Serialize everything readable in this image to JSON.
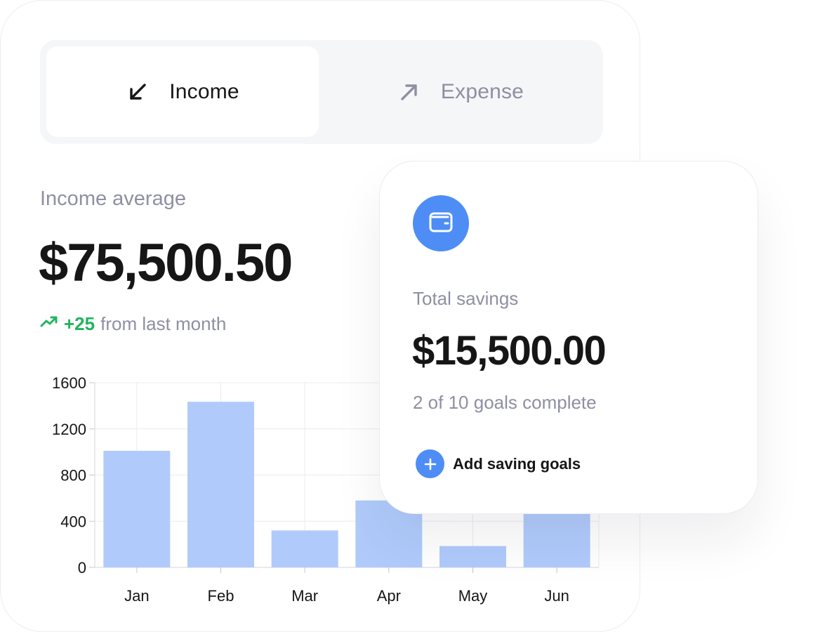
{
  "tabs": {
    "income": {
      "label": "Income",
      "icon": "arrow-down-left-icon",
      "active": true
    },
    "expense": {
      "label": "Expense",
      "icon": "arrow-up-right-icon",
      "active": false
    }
  },
  "summary": {
    "label": "Income average",
    "value": "$75,500.50",
    "trend_delta": "+25",
    "trend_text": "from last month",
    "trend_icon": "trending-up-icon"
  },
  "savings": {
    "icon": "wallet-icon",
    "label": "Total savings",
    "value": "$15,500.00",
    "goals_text": "2 of 10 goals complete",
    "add_label": "Add saving goals",
    "add_icon": "plus-icon"
  },
  "colors": {
    "accent": "#4e8df5",
    "bar": "#b0cbfb",
    "trend_positive": "#22b45e",
    "muted_text": "#8f8fa3",
    "text": "#161616"
  },
  "chart_data": {
    "type": "bar",
    "categories": [
      "Jan",
      "Feb",
      "Mar",
      "Apr",
      "May",
      "Jun"
    ],
    "values": [
      1010,
      1435,
      320,
      580,
      185,
      470
    ],
    "yticks": [
      0,
      400,
      800,
      1200,
      1600
    ],
    "ylim": [
      0,
      1600
    ],
    "grid": true,
    "title": "",
    "xlabel": "",
    "ylabel": ""
  }
}
